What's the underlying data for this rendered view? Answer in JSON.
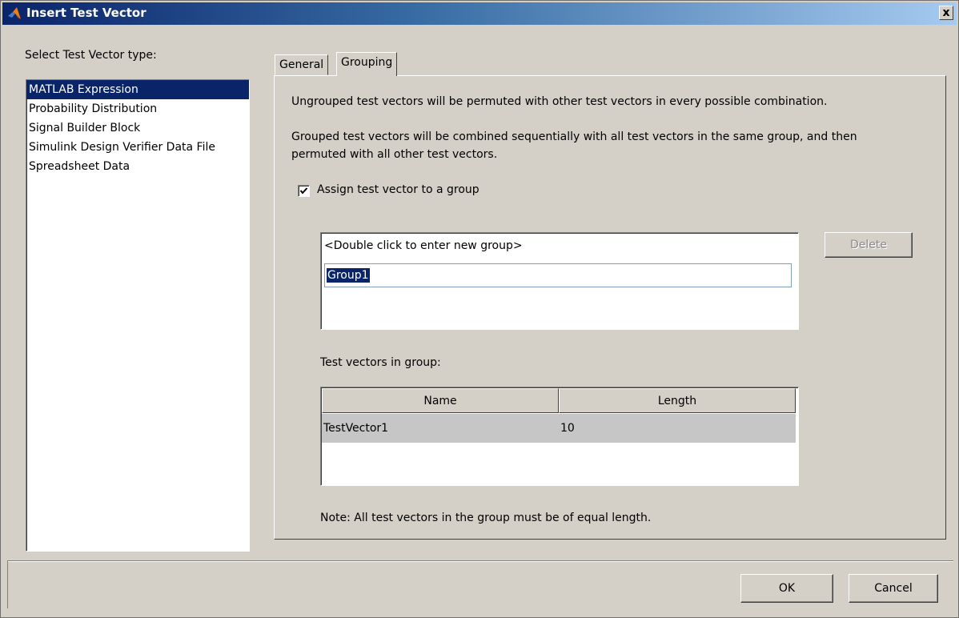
{
  "window": {
    "title": "Insert Test Vector",
    "close_label": "x",
    "icon": "matlab-logo-icon"
  },
  "left_panel": {
    "label": "Select Test Vector type:",
    "items": [
      {
        "label": "MATLAB Expression",
        "selected": true
      },
      {
        "label": "Probability Distribution"
      },
      {
        "label": "Signal Builder Block"
      },
      {
        "label": "Simulink Design Verifier Data File"
      },
      {
        "label": "Spreadsheet Data"
      }
    ]
  },
  "tabs": [
    {
      "label": "General",
      "active": false
    },
    {
      "label": "Grouping",
      "active": true
    }
  ],
  "grouping": {
    "para1": "Ungrouped test vectors will be permuted with other test vectors in every possible combination.",
    "para2_line1": "Grouped test vectors will be combined sequentially with all test vectors in the same group, and then",
    "para2_line2": "permuted with all other test vectors.",
    "assign_checkbox": {
      "label": "Assign test vector to a group",
      "checked": true
    },
    "group_list": {
      "hint": "<Double click to enter new group>",
      "editing_value": "Group1"
    },
    "delete_label": "Delete",
    "vectors_label": "Test vectors in group:",
    "table": {
      "columns": [
        "Name",
        "Length"
      ],
      "rows": [
        {
          "name": "TestVector1",
          "length": "10"
        }
      ]
    },
    "note": "Note: All test vectors in the group must be of equal length."
  },
  "footer": {
    "ok_label": "OK",
    "cancel_label": "Cancel"
  }
}
